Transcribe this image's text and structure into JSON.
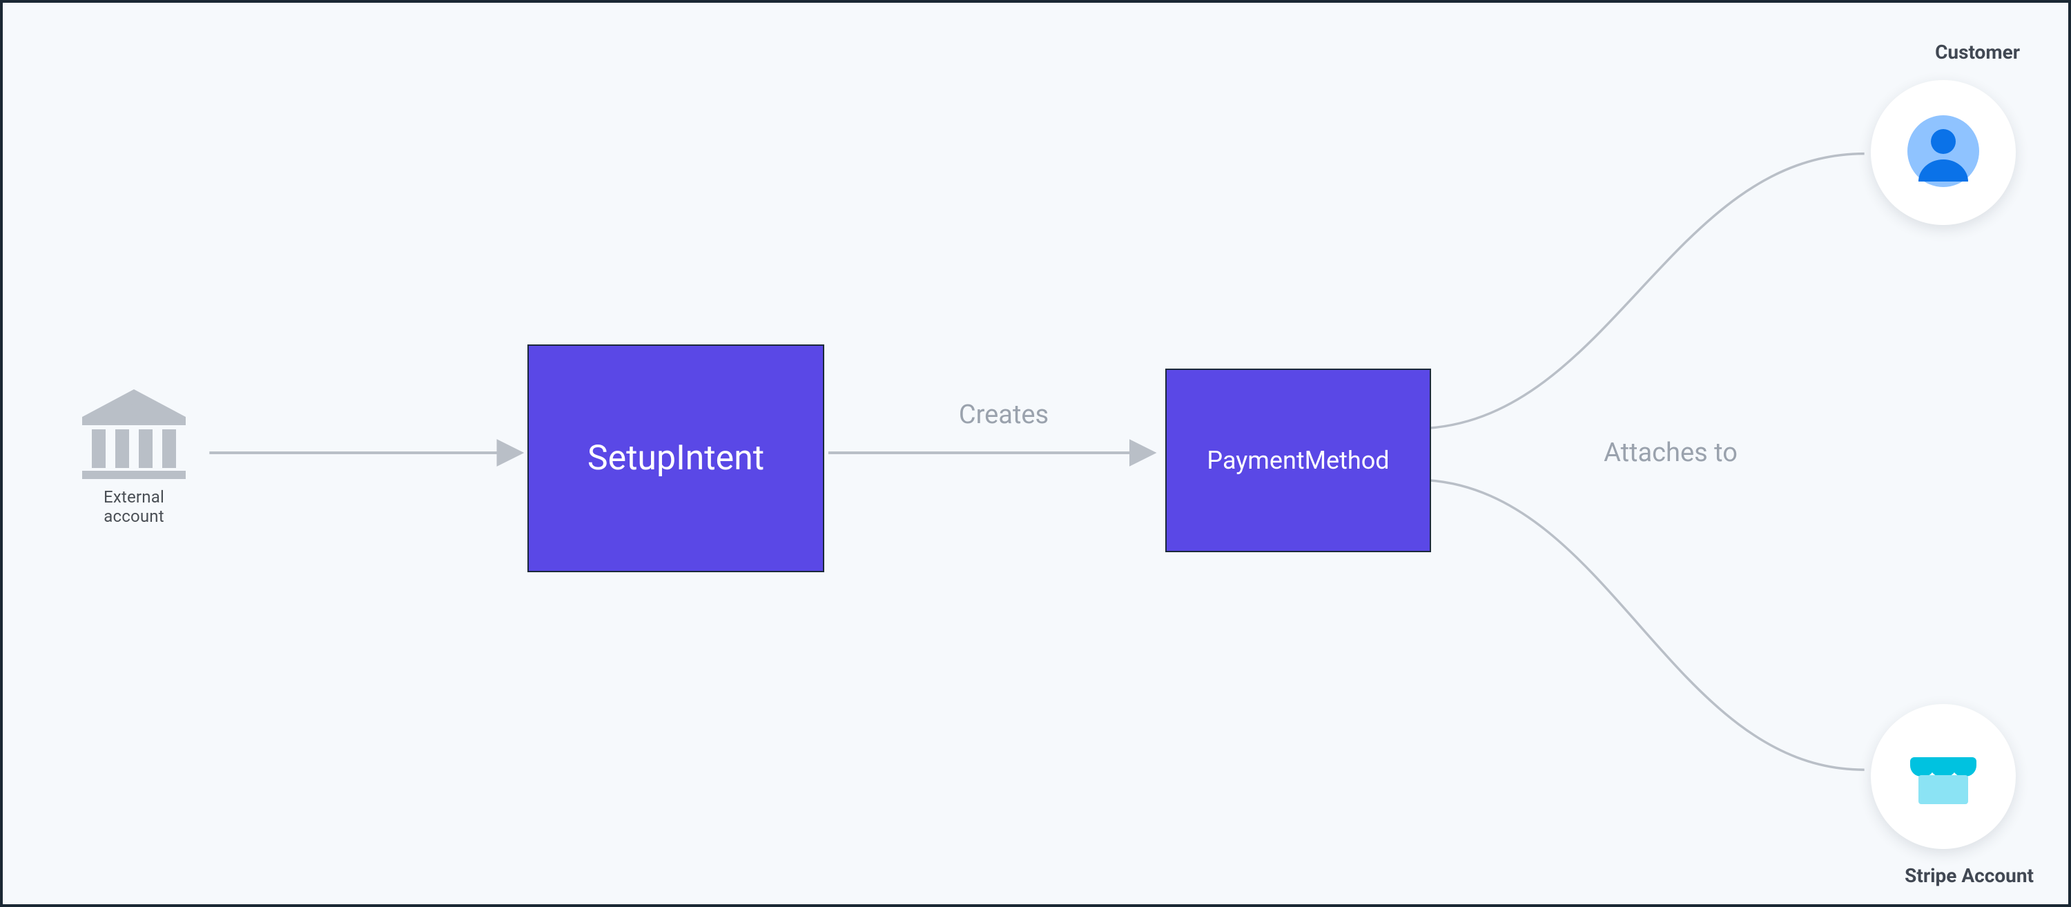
{
  "diagram": {
    "nodes": {
      "external_account": {
        "label": "External account",
        "icon": "bank-icon"
      },
      "setup_intent": {
        "label": "SetupIntent"
      },
      "payment_method": {
        "label": "PaymentMethod"
      },
      "customer": {
        "label": "Customer",
        "icon": "user-icon"
      },
      "stripe_account": {
        "label": "Stripe Account",
        "icon": "store-icon"
      }
    },
    "edges": {
      "ext_to_setup": {
        "from": "external_account",
        "to": "setup_intent",
        "label": ""
      },
      "setup_to_pm": {
        "from": "setup_intent",
        "to": "payment_method",
        "label": "Creates"
      },
      "pm_to_targets": {
        "from": "payment_method",
        "to": [
          "customer",
          "stripe_account"
        ],
        "label": "Attaches to"
      }
    },
    "colors": {
      "box_fill": "#5a48e6",
      "box_border": "#1c2a3a",
      "canvas": "#f6f9fc",
      "arrow": "#b9bfc7",
      "label": "#9aa2ad",
      "text_dark": "#414853",
      "blue_primary": "#0a72e8",
      "blue_light": "#8fc3ff",
      "cyan_primary": "#00c2e0",
      "cyan_light": "#8be3f4"
    }
  }
}
